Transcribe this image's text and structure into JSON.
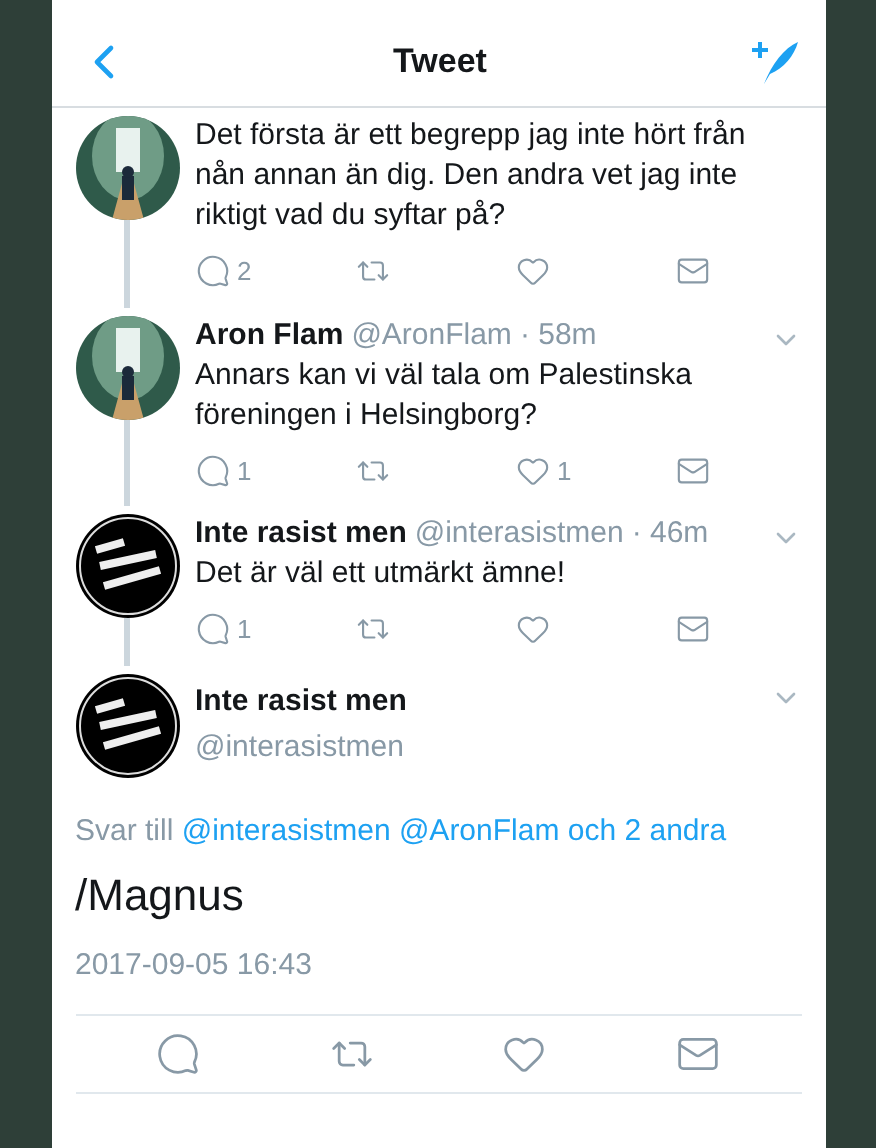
{
  "header": {
    "title": "Tweet"
  },
  "thread": [
    {
      "text": "Det första är ett begrepp jag inte hört från nån annan än dig. Den andra vet jag inte riktigt vad du syftar på?",
      "replies": "2"
    },
    {
      "name": "Aron Flam",
      "handle": "@AronFlam",
      "time": "· 58m",
      "text": "Annars kan vi väl tala om Palestinska föreningen i Helsingborg?",
      "replies": "1",
      "likes": "1"
    },
    {
      "avatar": {
        "kind": "logo"
      },
      "name": "Inte rasist men",
      "handle": "@interasistmen",
      "time": "· 46m",
      "text": "Det är väl ett utmärkt ämne!",
      "replies": "1"
    }
  ],
  "main": {
    "avatar": {
      "kind": "logo"
    },
    "name": "Inte rasist men",
    "handle": "@interasistmen",
    "reply_label": "Svar till",
    "reply_to": "@interasistmen @AronFlam och 2 andra",
    "text": "/Magnus",
    "date": "2017-09-05 16:43"
  }
}
